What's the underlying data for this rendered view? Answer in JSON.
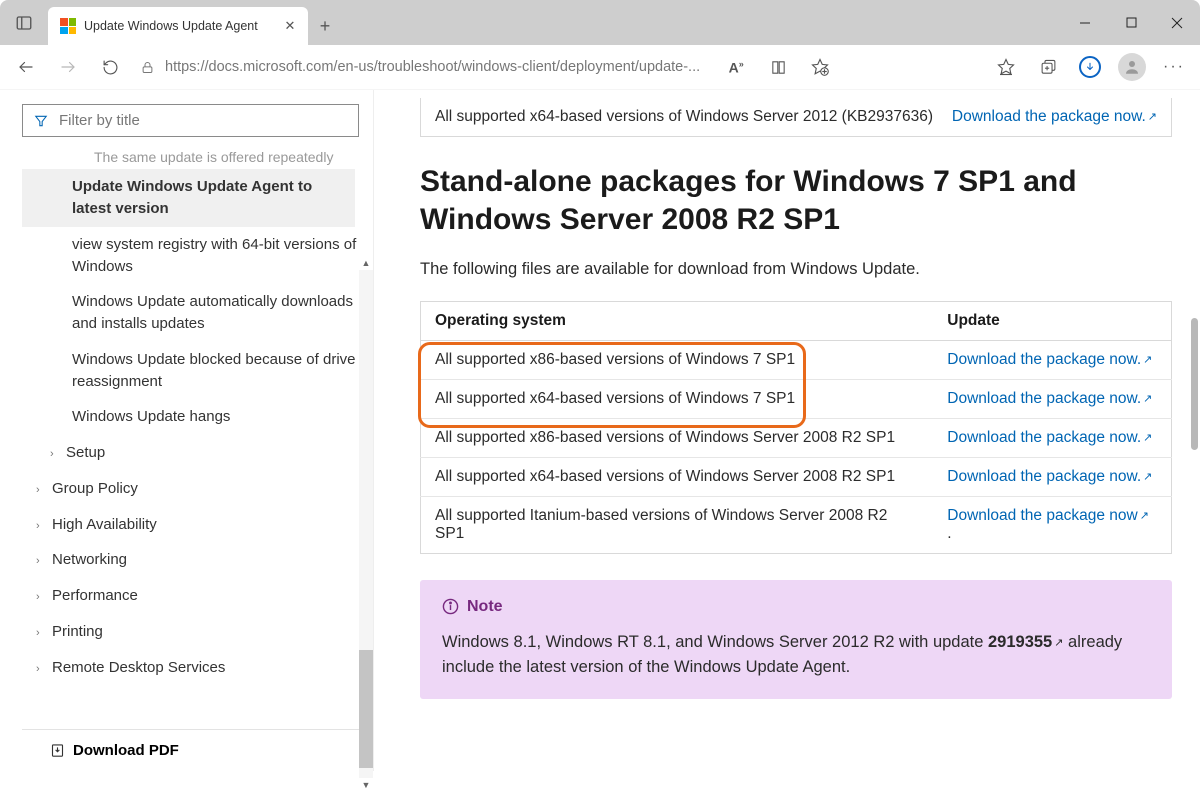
{
  "window": {
    "tab_title": "Update Windows Update Agent",
    "url_display": "https://docs.microsoft.com/en-us/troubleshoot/windows-client/deployment/update-..."
  },
  "sidebar": {
    "filter_placeholder": "Filter by title",
    "truncated": "The same update is offered repeatedly",
    "items": [
      "Update Windows Update Agent to latest version",
      "view system registry with 64-bit versions of Windows",
      "Windows Update automatically downloads and installs updates",
      "Windows Update blocked because of drive reassignment",
      "Windows Update hangs"
    ],
    "setup": "Setup",
    "roots": [
      "Group Policy",
      "High Availability",
      "Networking",
      "Performance",
      "Printing",
      "Remote Desktop Services"
    ],
    "download_pdf": "Download PDF"
  },
  "prev_row": {
    "os": "All supported x64-based versions of Windows Server 2012 (KB2937636)",
    "link": "Download the package now."
  },
  "heading": "Stand-alone packages for Windows 7 SP1 and Windows Server 2008 R2 SP1",
  "intro": "The following files are available for download from Windows Update.",
  "table": {
    "h1": "Operating system",
    "h2": "Update",
    "rows": [
      {
        "os": "All supported x86-based versions of Windows 7 SP1",
        "link": "Download the package now."
      },
      {
        "os": "All supported x64-based versions of Windows 7 SP1",
        "link": "Download the package now."
      },
      {
        "os": "All supported x86-based versions of Windows Server 2008 R2 SP1",
        "link": "Download the package now."
      },
      {
        "os": "All supported x64-based versions of Windows Server 2008 R2 SP1",
        "link": "Download the package now."
      },
      {
        "os": "All supported Itanium-based versions of Windows Server 2008 R2 SP1",
        "link": "Download the package now"
      }
    ]
  },
  "note": {
    "label": "Note",
    "text_a": "Windows 8.1, Windows RT 8.1, and Windows Server 2012 R2 with update ",
    "kb": "2919355",
    "text_b": " already include the latest version of the Windows Update Agent."
  }
}
